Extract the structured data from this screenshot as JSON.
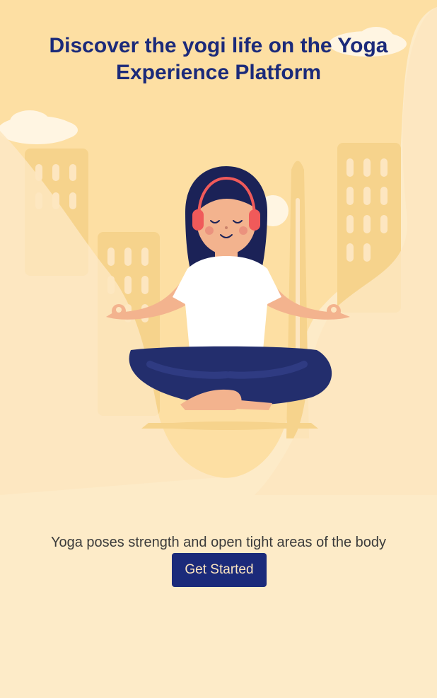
{
  "hero": {
    "headline": "Discover the yogi life on the Yoga Experience Platform",
    "illustration": "meditating-woman-with-headphones-city-background"
  },
  "content": {
    "tagline": "Yoga poses strength and open tight areas of the body",
    "cta_label": "Get Started"
  },
  "colors": {
    "background": "#fdebc8",
    "hero_background": "#fddfa3",
    "primary": "#1b2a7a",
    "button_text": "#fde6c0",
    "body_text": "#3b3b3b"
  }
}
